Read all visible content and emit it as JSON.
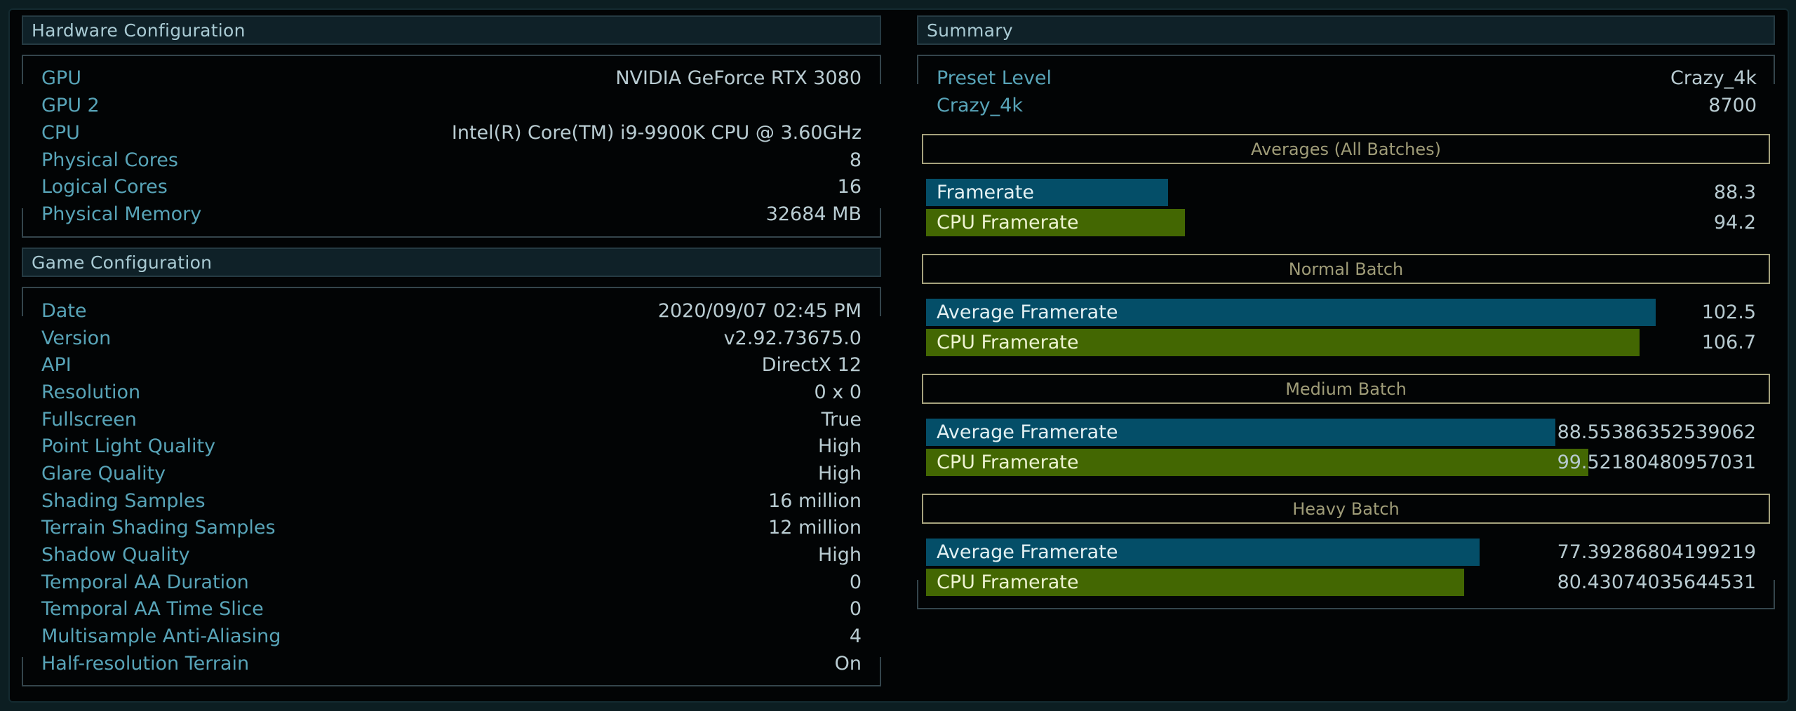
{
  "hardware": {
    "title": "Hardware Configuration",
    "rows": [
      {
        "label": "GPU",
        "value": "NVIDIA GeForce RTX 3080"
      },
      {
        "label": "GPU 2",
        "value": ""
      },
      {
        "label": "CPU",
        "value": "Intel(R) Core(TM) i9-9900K CPU @ 3.60GHz"
      },
      {
        "label": "Physical Cores",
        "value": "8"
      },
      {
        "label": "Logical Cores",
        "value": "16"
      },
      {
        "label": "Physical Memory",
        "value": "32684 MB"
      }
    ]
  },
  "game": {
    "title": "Game Configuration",
    "rows": [
      {
        "label": "Date",
        "value": "2020/09/07 02:45 PM"
      },
      {
        "label": "Version",
        "value": "v2.92.73675.0"
      },
      {
        "label": "API",
        "value": "DirectX 12"
      },
      {
        "label": "Resolution",
        "value": "0 x 0"
      },
      {
        "label": "Fullscreen",
        "value": "True"
      },
      {
        "label": "Point Light Quality",
        "value": "High"
      },
      {
        "label": "Glare Quality",
        "value": "High"
      },
      {
        "label": "Shading Samples",
        "value": "16 million"
      },
      {
        "label": "Terrain Shading Samples",
        "value": "12 million"
      },
      {
        "label": "Shadow Quality",
        "value": "High"
      },
      {
        "label": "Temporal AA Duration",
        "value": "0"
      },
      {
        "label": "Temporal AA Time Slice",
        "value": "0"
      },
      {
        "label": "Multisample Anti-Aliasing",
        "value": "4"
      },
      {
        "label": "Half-resolution Terrain",
        "value": "On"
      }
    ]
  },
  "summary": {
    "title": "Summary",
    "rows": [
      {
        "label": "Preset Level",
        "value": "Crazy_4k"
      },
      {
        "label": "Crazy_4k",
        "value": "8700"
      }
    ],
    "colors": {
      "gpu_bar": "#044e68",
      "cpu_bar": "#436702",
      "batch_border": "#a5a27d"
    },
    "batches": [
      {
        "title": "Averages (All Batches)",
        "bars": [
          {
            "label": "Framerate",
            "value": "88.3",
            "fill": 0.292,
            "kind": "gpu"
          },
          {
            "label": "CPU Framerate",
            "value": "94.2",
            "fill": 0.312,
            "kind": "cpu"
          }
        ]
      },
      {
        "title": "Normal Batch",
        "bars": [
          {
            "label": "Average Framerate",
            "value": "102.5",
            "fill": 0.879,
            "kind": "gpu"
          },
          {
            "label": "CPU Framerate",
            "value": "106.7",
            "fill": 0.86,
            "kind": "cpu"
          }
        ]
      },
      {
        "title": "Medium Batch",
        "bars": [
          {
            "label": "Average Framerate",
            "value": "88.55386352539062",
            "fill": 0.758,
            "kind": "gpu"
          },
          {
            "label": "CPU Framerate",
            "value": "99.52180480957031",
            "fill": 0.798,
            "kind": "cpu"
          }
        ]
      },
      {
        "title": "Heavy Batch",
        "bars": [
          {
            "label": "Average Framerate",
            "value": "77.39286804199219",
            "fill": 0.667,
            "kind": "gpu"
          },
          {
            "label": "CPU Framerate",
            "value": "80.43074035644531",
            "fill": 0.648,
            "kind": "cpu"
          }
        ]
      }
    ]
  }
}
